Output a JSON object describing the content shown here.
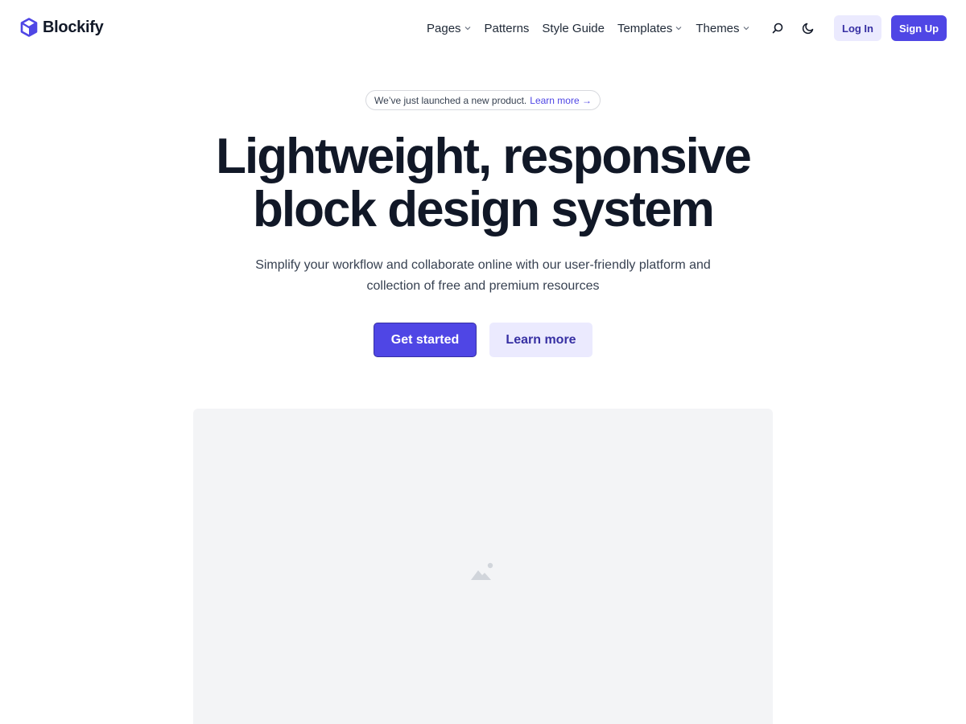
{
  "brand": {
    "name": "Blockify",
    "logo_icon": "cube-icon",
    "accent_color": "#4f46e5",
    "accent_light": "#ebeafe"
  },
  "nav": {
    "items": [
      {
        "label": "Pages",
        "has_dropdown": true
      },
      {
        "label": "Patterns",
        "has_dropdown": false
      },
      {
        "label": "Style Guide",
        "has_dropdown": false
      },
      {
        "label": "Templates",
        "has_dropdown": true
      },
      {
        "label": "Themes",
        "has_dropdown": true
      }
    ],
    "search_icon": "search-icon",
    "theme_icon": "moon-icon",
    "login_label": "Log In",
    "signup_label": "Sign Up"
  },
  "hero": {
    "announcement_text": "We’ve just launched a new product.",
    "announcement_link": "Learn more →",
    "title_line1": "Lightweight, responsive",
    "title_line2": "block design system",
    "subtitle_line1": "Simplify your workflow and collaborate online with our user-friendly platform and",
    "subtitle_line2": "collection of free and premium resources",
    "primary_cta": "Get started",
    "secondary_cta": "Learn more"
  },
  "media": {
    "placeholder_icon": "image-placeholder-icon"
  }
}
